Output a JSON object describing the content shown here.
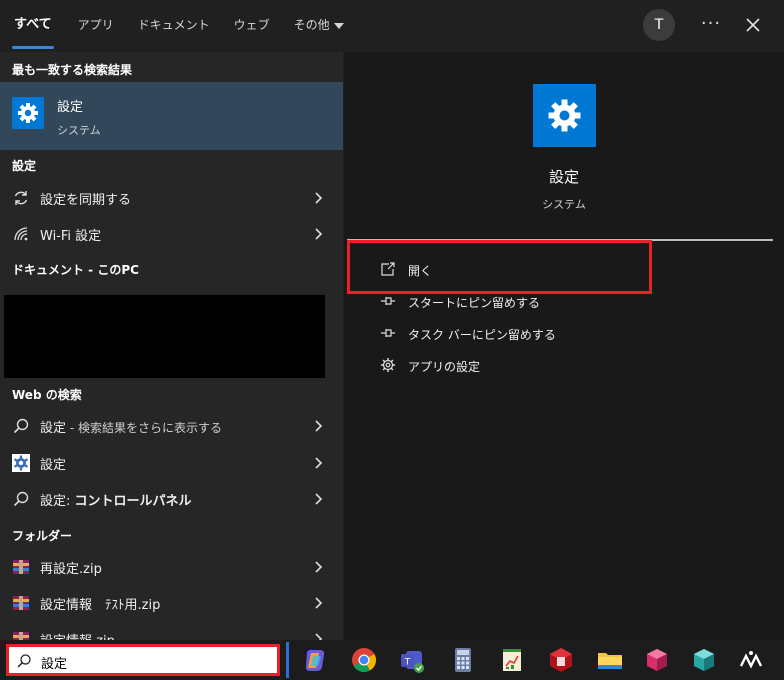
{
  "tabs": [
    {
      "label": "すべて",
      "active": true
    },
    {
      "label": "アプリ"
    },
    {
      "label": "ドキュメント"
    },
    {
      "label": "ウェブ"
    },
    {
      "label": "その他"
    }
  ],
  "header": {
    "avatar_initial": "T",
    "more_label": "···"
  },
  "left": {
    "best_match_header": "最も一致する検索結果",
    "best_match": {
      "title": "設定",
      "subtitle": "システム",
      "icon": "gear-icon"
    },
    "settings_header": "設定",
    "settings_items": [
      {
        "label": "設定を同期する",
        "icon": "sync-icon"
      },
      {
        "label": "Wi-Fi 設定",
        "icon": "wifi-icon"
      }
    ],
    "documents_header": "ドキュメント - このPC",
    "web_header": "Web の検索",
    "web_items": [
      {
        "label": "設定",
        "suffix": " - 検索結果をさらに表示する",
        "icon": "search-icon"
      },
      {
        "label": "設定",
        "suffix": "",
        "icon": "settings-web-icon"
      },
      {
        "label": "設定: ",
        "suffix": "コントロールパネル",
        "icon": "search-icon"
      }
    ],
    "folders_header": "フォルダー",
    "folder_items": [
      {
        "label": "再設定.zip",
        "icon": "zip-icon"
      },
      {
        "label": "設定情報　ﾃｽﾄ用.zip",
        "icon": "zip-icon"
      },
      {
        "label": "設定情報.zip",
        "icon": "zip-icon"
      }
    ]
  },
  "right": {
    "title": "設定",
    "subtitle": "システム",
    "actions": [
      {
        "label": "開く",
        "icon": "open-icon"
      },
      {
        "label": "スタートにピン留めする",
        "icon": "pin-icon"
      },
      {
        "label": "タスク バーにピン留めする",
        "icon": "pin-icon"
      },
      {
        "label": "アプリの設定",
        "icon": "gear-icon"
      }
    ]
  },
  "taskbar": {
    "search_value": "設定",
    "apps": [
      "copilot-icon",
      "chrome-icon",
      "teams-icon",
      "calculator-icon",
      "notepad-chart-icon",
      "red-box-icon",
      "file-explorer-icon",
      "cube-pink-icon",
      "cube-teal-icon",
      "custom-app-icon"
    ]
  },
  "colors": {
    "accent": "#0078d4",
    "highlight": "#e8202a",
    "tab_underline": "#3a86d8"
  }
}
